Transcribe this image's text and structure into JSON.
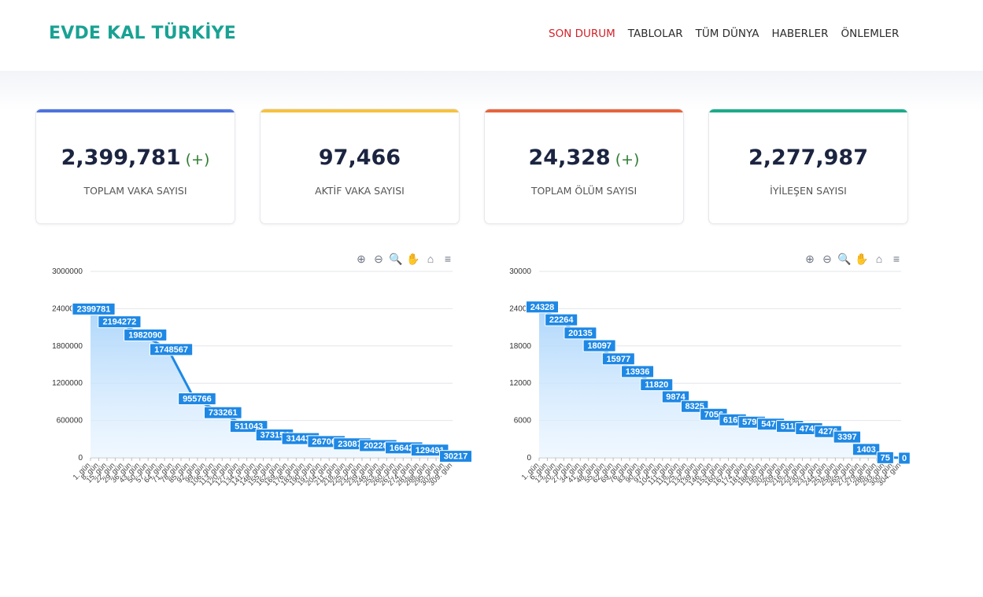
{
  "header": {
    "brand": "EVDE KAL TÜRKİYE",
    "nav": [
      "SON DURUM",
      "TABLOLAR",
      "TÜM DÜNYA",
      "HABERLER",
      "ÖNLEMLER"
    ],
    "active_nav": "SON DURUM"
  },
  "cards": [
    {
      "value": "2,399,781",
      "plus": "(+)",
      "label": "TOPLAM VAKA SAYISI",
      "accent": "#4e73df"
    },
    {
      "value": "97,466",
      "plus": "",
      "label": "AKTİF VAKA SAYISI",
      "accent": "#f6c23e"
    },
    {
      "value": "24,328",
      "plus": "(+)",
      "label": "TOPLAM ÖLÜM SAYISI",
      "accent": "#e8643c"
    },
    {
      "value": "2,277,987",
      "plus": "",
      "label": "İYİLEŞEN SAYISI",
      "accent": "#1cab8a"
    }
  ],
  "toolbar_icons": [
    "zoom-in-icon",
    "zoom-out-icon",
    "selection-zoom-icon",
    "pan-hand-icon",
    "home-icon",
    "menu-icon"
  ],
  "chart_data": [
    {
      "type": "area",
      "ylim": [
        0,
        3000000
      ],
      "yticks": [
        "3000000",
        "2400000",
        "1800000",
        "1200000",
        "600000",
        "0"
      ],
      "x": [
        "1. gün",
        "8. gün",
        "15. gün",
        "22. gün",
        "29. gün",
        "36. gün",
        "43. gün",
        "50. gün",
        "57. gün",
        "64. gün",
        "71. gün",
        "78. gün",
        "85. gün",
        "92. gün",
        "99. gün",
        "106. gün",
        "113. gün",
        "120. gün",
        "127. gün",
        "134. gün",
        "141. gün",
        "148. gün",
        "155. gün",
        "162. gün",
        "169. gün",
        "176. gün",
        "183. gün",
        "190. gün",
        "197. gün",
        "204. gün",
        "211. gün",
        "218. gün",
        "225. gün",
        "232. gün",
        "239. gün",
        "246. gün",
        "253. gün",
        "260. gün",
        "267. gün",
        "274. gün",
        "281. gün",
        "288. gün",
        "295. gün",
        "302. gün",
        "309. gün"
      ],
      "last_tick": "306. gün",
      "values": [
        2399781,
        2194272,
        1982090,
        1748567,
        955766,
        733261,
        511043,
        373154,
        314433,
        267064,
        230873,
        202284,
        166422,
        129491,
        30217
      ],
      "labels": [
        "2399781",
        "2194272",
        "1982090",
        "1748567",
        "955766",
        "733261",
        "511043",
        "373154",
        "314433",
        "267064",
        "230873",
        "202284",
        "166422",
        "129491",
        "30217"
      ]
    },
    {
      "type": "area",
      "ylim": [
        0,
        30000
      ],
      "yticks": [
        "30000",
        "24000",
        "18000",
        "12000",
        "6000",
        "0"
      ],
      "x": [
        "1. gün",
        "6. gün",
        "13. gün",
        "20. gün",
        "27. gün",
        "34. gün",
        "41. gün",
        "48. gün",
        "55. gün",
        "62. gün",
        "69. gün",
        "76. gün",
        "83. gün",
        "90. gün",
        "97. gün",
        "104. gün",
        "111. gün",
        "118. gün",
        "125. gün",
        "132. gün",
        "139. gün",
        "146. gün",
        "153. gün",
        "160. gün",
        "167. gün",
        "174. gün",
        "181. gün",
        "188. gün",
        "195. gün",
        "202. gün",
        "209. gün",
        "216. gün",
        "223. gün",
        "230. gün",
        "237. gün",
        "244. gün",
        "251. gün",
        "258. gün",
        "265. gün",
        "272. gün",
        "279. gün",
        "286. gün",
        "293. gün",
        "300. gün",
        "304. gün"
      ],
      "values": [
        24328,
        22264,
        20135,
        18097,
        15977,
        13936,
        11820,
        9874,
        8325,
        7056,
        6163,
        5798,
        5475,
        5115,
        4746,
        4276,
        3397,
        1403,
        75,
        0
      ],
      "labels": [
        "24328",
        "22264",
        "20135",
        "18097",
        "15977",
        "13936",
        "11820",
        "9874",
        "8325",
        "7056",
        "6163",
        "5798",
        "5475",
        "5115",
        "4746",
        "4276",
        "3397",
        "1403",
        "75",
        "0"
      ]
    }
  ]
}
